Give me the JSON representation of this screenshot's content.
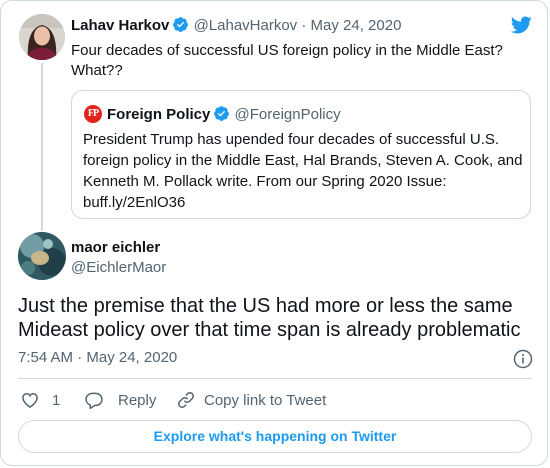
{
  "reply": {
    "author_name": "Lahav Harkov",
    "author_handle": "@LahavHarkov",
    "separator": "·",
    "date": "May 24, 2020",
    "text": "Four decades of successful US foreign policy in the Middle East? What??"
  },
  "quoted": {
    "logo_text": "FP",
    "author_name": "Foreign Policy",
    "author_handle": "@ForeignPolicy",
    "text": "President Trump has upended four decades of successful U.S. foreign policy in the Middle East, Hal Brands, Steven A. Cook, and Kenneth M. Pollack write. From our Spring 2020 Issue: buff.ly/2EnlO36"
  },
  "tweet": {
    "author_name": "maor eichler",
    "author_handle": "@EichlerMaor",
    "text": "Just the premise that the US had more or less the same Mideast policy over that time span is already problematic",
    "time": "7:54 AM · May 24, 2020"
  },
  "actions": {
    "like_count": "1",
    "reply_label": "Reply",
    "copy_link_label": "Copy link to Tweet"
  },
  "explore_label": "Explore what's happening on Twitter",
  "colors": {
    "accent": "#1d9bf0",
    "text": "#0f1419",
    "secondary": "#536471",
    "border": "#cfd9de",
    "fp_red": "#e2231a"
  },
  "icons": [
    "twitter-bird-icon",
    "verified-badge-icon",
    "info-icon",
    "heart-icon",
    "reply-bubble-icon",
    "link-icon"
  ]
}
